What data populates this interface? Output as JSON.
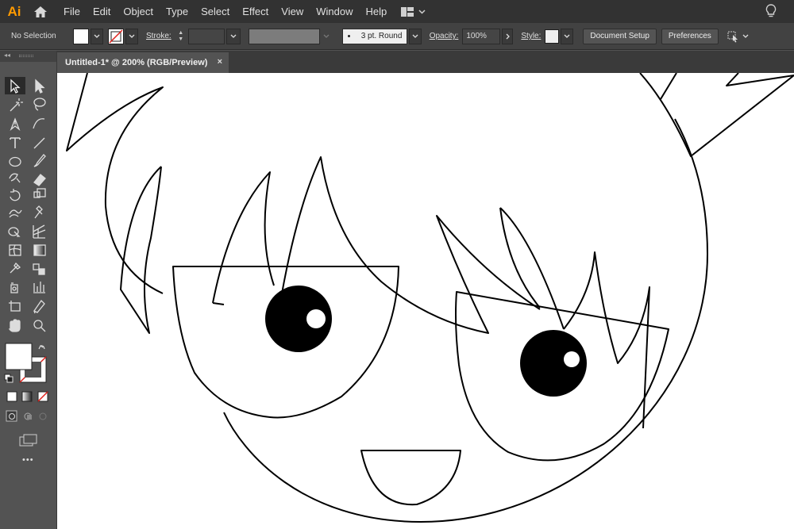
{
  "app": {
    "logo": "Ai"
  },
  "menu": {
    "items": [
      "File",
      "Edit",
      "Object",
      "Type",
      "Select",
      "Effect",
      "View",
      "Window",
      "Help"
    ]
  },
  "control": {
    "selection": "No Selection",
    "stroke_label": "Stroke:",
    "stroke_profile": "3 pt. Round",
    "opacity_label": "Opacity:",
    "opacity_value": "100%",
    "style_label": "Style:",
    "document_setup": "Document Setup",
    "preferences": "Preferences"
  },
  "tab": {
    "title": "Untitled-1* @ 200% (RGB/Preview)",
    "close": "×"
  },
  "toolbar": {
    "more": "•••"
  },
  "colors": {
    "accent": "#ff9a00",
    "ui_dark": "#323232",
    "ui_panel": "#535353",
    "canvas": "#ffffff",
    "none_red": "#e0211c"
  },
  "icons": [
    "home-icon",
    "workspace-icon",
    "lightbulb-icon",
    "selection-tool-icon",
    "direct-selection-tool-icon",
    "magic-wand-icon",
    "lasso-icon",
    "pen-icon",
    "curvature-icon",
    "type-icon",
    "line-icon",
    "ellipse-icon",
    "paintbrush-icon",
    "shaper-icon",
    "eraser-icon",
    "rotate-icon",
    "scale-icon",
    "warp-icon",
    "puppet-warp-icon",
    "shape-builder-icon",
    "perspective-grid-icon",
    "mesh-icon",
    "gradient-icon",
    "eyedropper-icon",
    "blend-icon",
    "symbol-sprayer-icon",
    "graph-icon",
    "artboard-icon",
    "slice-icon",
    "hand-icon",
    "zoom-icon"
  ]
}
